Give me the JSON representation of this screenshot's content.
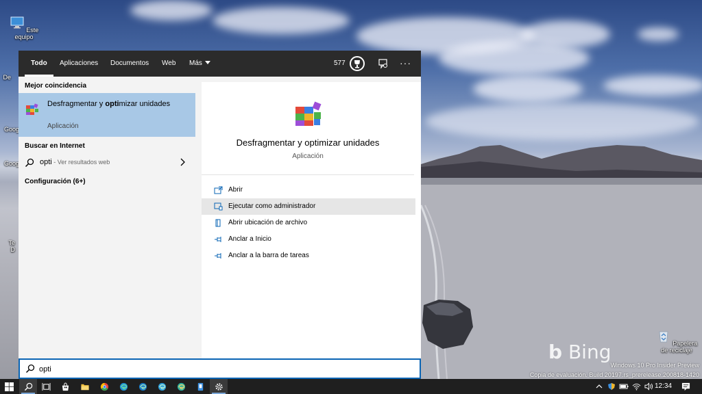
{
  "desktop": {
    "icons": [
      {
        "label": "Este equipo"
      },
      {
        "label": "Papelera de reciclaje"
      }
    ],
    "partial_labels": [
      "De",
      "Goog",
      "Goog",
      "Te",
      "D"
    ],
    "bing_logo": "Bing",
    "watermark": {
      "line1": "Windows 10 Pro Insider Preview",
      "line2": "Copia de evaluación. Build 20197.rs_prerelease.200818-1420"
    }
  },
  "search_panel": {
    "tabs": [
      {
        "label": "Todo",
        "active": true
      },
      {
        "label": "Aplicaciones"
      },
      {
        "label": "Documentos"
      },
      {
        "label": "Web"
      },
      {
        "label": "Más"
      }
    ],
    "rewards_points": "577",
    "best_match_header": "Mejor coincidencia",
    "best_match": {
      "title_pre": "Desfragmentar y ",
      "title_bold": "opti",
      "title_post": "mizar unidades",
      "subtitle": "Aplicación"
    },
    "internet_header": "Buscar en Internet",
    "web_result": {
      "term": "opti",
      "hint": " - Ver resultados web"
    },
    "settings_header": "Configuración (6+)",
    "preview": {
      "title": "Desfragmentar y optimizar unidades",
      "subtitle": "Aplicación",
      "actions": [
        {
          "label": "Abrir",
          "icon": "open-icon"
        },
        {
          "label": "Ejecutar como administrador",
          "icon": "run-as-admin-icon"
        },
        {
          "label": "Abrir ubicación de archivo",
          "icon": "file-location-icon"
        },
        {
          "label": "Anclar a Inicio",
          "icon": "pin-icon"
        },
        {
          "label": "Anclar a la barra de tareas",
          "icon": "pin-icon"
        }
      ]
    },
    "search_query": "opti"
  },
  "taskbar": {
    "clock": "12:34"
  },
  "colors": {
    "accent": "#0a64b4",
    "selected": "#a8c8e6",
    "topbar": "#2b2b2b",
    "taskbar": "#1f1f1f"
  }
}
